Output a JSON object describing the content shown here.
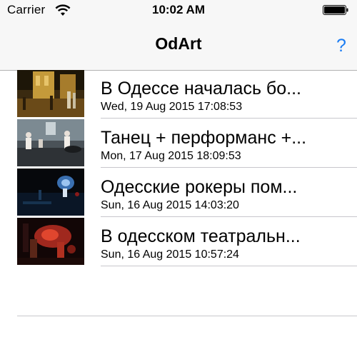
{
  "status_bar": {
    "carrier": "Carrier",
    "time": "10:02 AM",
    "wifi_icon": "wifi-icon",
    "battery_icon": "battery-full-icon"
  },
  "navbar": {
    "title": "OdArt",
    "help_label": "?",
    "accent_color": "#1a7cf3"
  },
  "articles": [
    {
      "title": "В Одессе началась бо...",
      "date": "Wed, 19 Aug 2015 17:08:53",
      "thumbnail": "photo-street-night"
    },
    {
      "title": "Танец + перформанс +...",
      "date": "Mon, 17 Aug 2015 18:09:53",
      "thumbnail": "photo-dancers"
    },
    {
      "title": "Одесские рокеры пом...",
      "date": "Sun, 16 Aug 2015 14:03:20",
      "thumbnail": "photo-concert-stage"
    },
    {
      "title": "В одесском театральн...",
      "date": "Sun, 16 Aug 2015 10:57:24",
      "thumbnail": "photo-theatre-red"
    }
  ]
}
